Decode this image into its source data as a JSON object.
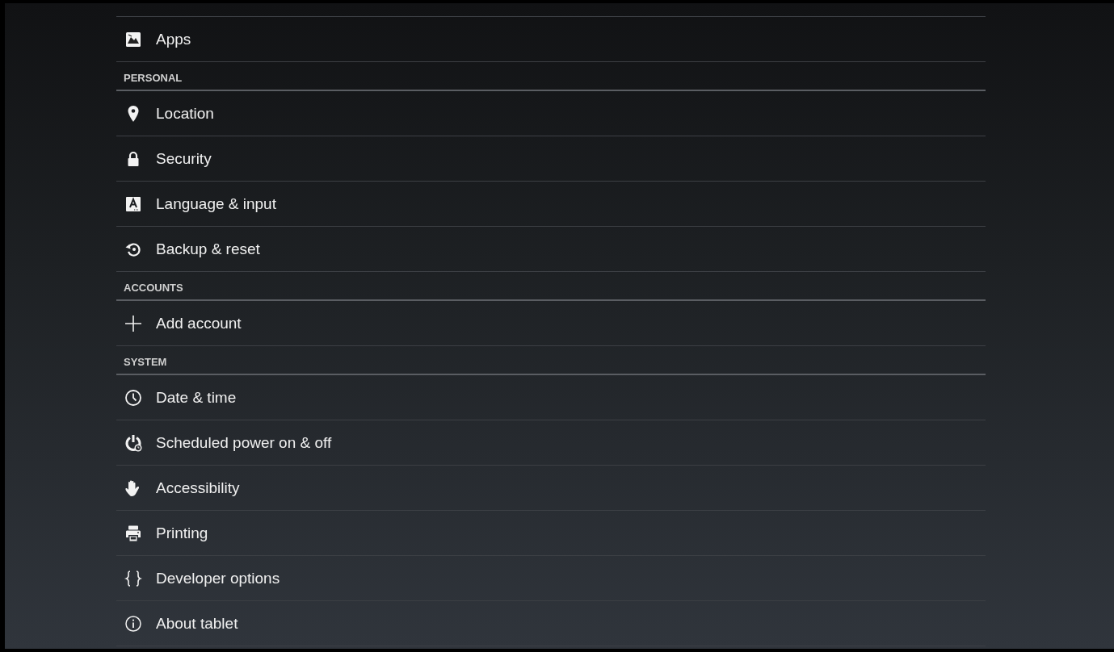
{
  "sections": [
    {
      "items": [
        {
          "label": "Apps",
          "kind": "apps"
        }
      ]
    },
    {
      "header": "PERSONAL",
      "items": [
        {
          "label": "Location",
          "kind": "location"
        },
        {
          "label": "Security",
          "kind": "security"
        },
        {
          "label": "Language & input",
          "kind": "language"
        },
        {
          "label": "Backup & reset",
          "kind": "backup"
        }
      ]
    },
    {
      "header": "ACCOUNTS",
      "items": [
        {
          "label": "Add account",
          "kind": "add"
        }
      ]
    },
    {
      "header": "SYSTEM",
      "items": [
        {
          "label": "Date & time",
          "kind": "clock"
        },
        {
          "label": "Scheduled power on & off",
          "kind": "power"
        },
        {
          "label": "Accessibility",
          "kind": "hand"
        },
        {
          "label": "Printing",
          "kind": "printer"
        },
        {
          "label": "Developer options",
          "kind": "braces"
        },
        {
          "label": "About tablet",
          "kind": "info"
        }
      ]
    }
  ]
}
